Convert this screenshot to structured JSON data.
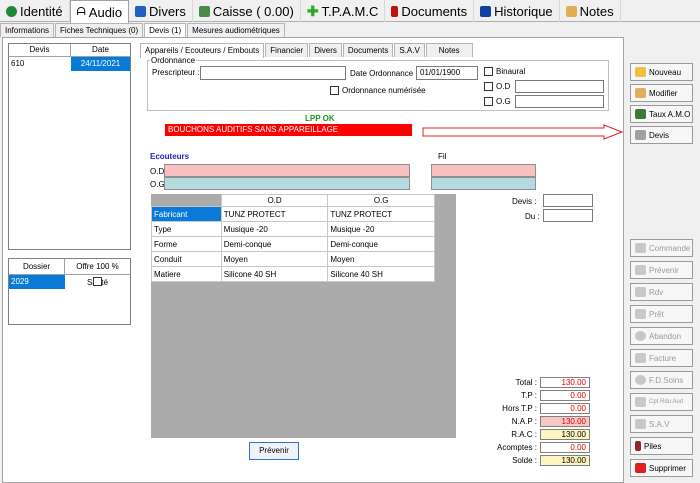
{
  "top_tabs": [
    {
      "label": "Identité"
    },
    {
      "label": "Audio"
    },
    {
      "label": "Divers"
    },
    {
      "label": "Caisse ( 0.00)"
    },
    {
      "label": "T.P.A.M.C"
    },
    {
      "label": "Documents"
    },
    {
      "label": "Historique"
    },
    {
      "label": "Notes"
    }
  ],
  "sub_tabs": [
    {
      "label": "Informations"
    },
    {
      "label": "Fiches Techniques (0)"
    },
    {
      "label": "Devis (1)"
    },
    {
      "label": "Mesures audiométriques"
    }
  ],
  "inner_tabs": [
    {
      "label": "Appareils / Ecouteurs / Embouts"
    },
    {
      "label": "Financier"
    },
    {
      "label": "Divers"
    },
    {
      "label": "Documents"
    },
    {
      "label": "S.A.V"
    },
    {
      "label": "Notes"
    }
  ],
  "devis_grid": {
    "col_devis": "Devis",
    "col_date": "Date",
    "rows": [
      {
        "devis": "610",
        "date": "24/11/2021"
      }
    ]
  },
  "dossier_grid": {
    "col_dossier": "Dossier",
    "col_offre": "Offre 100 % Santé",
    "rows": [
      {
        "dossier": "2029"
      }
    ]
  },
  "ordonnance": {
    "legend": "Ordonnance",
    "prescripteur_label": "Prescripteur :",
    "prescripteur_value": "",
    "date_label": "Date Ordonnance :",
    "date_value": "01/01/1900",
    "numerisee_label": "Ordonnance numérisée",
    "binaural_label": "Binaural",
    "od_label": "O.D",
    "og_label": "O.G"
  },
  "lpp": {
    "status": "LPP OK",
    "banner": "BOUCHONS AUDITIFS SANS APPAREILLAGE"
  },
  "ecouteurs": {
    "title": "Ecouteurs",
    "fil_label": "Fil",
    "od_label": "O.D",
    "og_label": "O.G"
  },
  "devis_field": {
    "devis_label": "Devis :",
    "du_label": "Du :"
  },
  "table": {
    "col_od": "O.D",
    "col_og": "O.G",
    "rows": [
      {
        "label": "Fabricant",
        "od": "TUNZ PROTECT",
        "og": "TUNZ PROTECT"
      },
      {
        "label": "Type",
        "od": "Musique -20",
        "og": "Musique -20"
      },
      {
        "label": "Forme",
        "od": "Demi-conque",
        "og": "Demi-conque"
      },
      {
        "label": "Conduit",
        "od": "Moyen",
        "og": "Moyen"
      },
      {
        "label": "Matiere",
        "od": "Silicone 40 SH",
        "og": "Silicone 40 SH"
      }
    ]
  },
  "prevenir_button": "Prévenir",
  "totals": [
    {
      "label": "Total :",
      "value": "130.00",
      "bg": "#ffffff"
    },
    {
      "label": "T.P :",
      "value": "0.00",
      "bg": "#ffffff"
    },
    {
      "label": "Hors T.P :",
      "value": "0.00",
      "bg": "#ffffff"
    },
    {
      "label": "N.A.P :",
      "value": "130.00",
      "bg": "#f8c8c8"
    },
    {
      "label": "R.A.C :",
      "value": "130.00",
      "bg": "#fff5c0"
    },
    {
      "label": "Acomptes :",
      "value": "0.00",
      "bg": "#ffffff"
    },
    {
      "label": "Solde :",
      "value": "130.00",
      "bg": "#fff5c0"
    }
  ],
  "side_buttons_top": [
    {
      "label": "Nouveau",
      "icon": "plus-icon"
    },
    {
      "label": "Modifier",
      "icon": "edit-icon"
    },
    {
      "label": "Taux A.M.O",
      "icon": "money-icon"
    },
    {
      "label": "Devis",
      "icon": "hands-icon"
    }
  ],
  "side_buttons_bottom": [
    {
      "label": "Commande",
      "icon": "gear-icon",
      "disabled": true
    },
    {
      "label": "Prévenir",
      "icon": "phone-icon",
      "disabled": true
    },
    {
      "label": "Rdv",
      "icon": "calendar-icon",
      "disabled": true
    },
    {
      "label": "Prêt",
      "icon": "lend-icon",
      "disabled": true
    },
    {
      "label": "Abandon",
      "icon": "abandon-icon",
      "disabled": true
    },
    {
      "label": "Facture",
      "icon": "invoice-icon",
      "disabled": true
    },
    {
      "label": "F.D.Soins",
      "icon": "doc-icon",
      "disabled": true
    },
    {
      "label": "Cpt Rdu Aud",
      "icon": "pin-icon",
      "disabled": true
    },
    {
      "label": "S.A.V",
      "icon": "sav-icon",
      "disabled": true
    },
    {
      "label": "Piles",
      "icon": "battery-icon",
      "disabled": false
    },
    {
      "label": "Supprimer",
      "icon": "delete-icon",
      "disabled": false
    }
  ],
  "colors": {
    "accent": "#0a7ad8",
    "lpp_green": "#1a9a1a",
    "banner_red": "#ff0000",
    "od_pink": "#f8c0c0",
    "og_blue": "#b4dce0",
    "ecouteurs_blue": "#2020c0"
  }
}
